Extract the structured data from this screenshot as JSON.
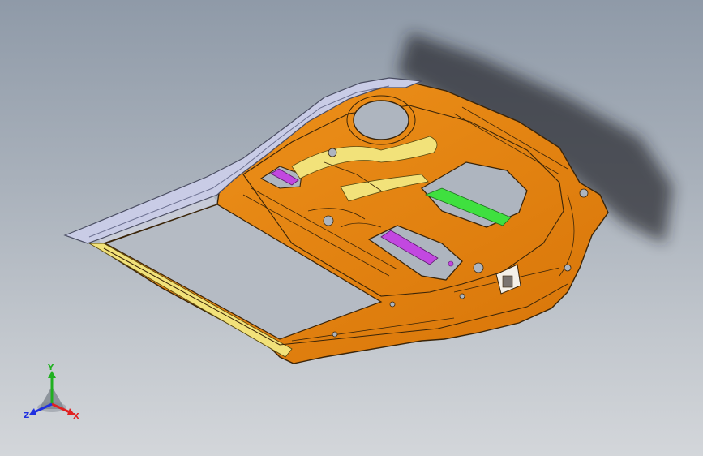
{
  "viewport": {
    "background_top": "#8f9aa8",
    "background_bottom": "#d3d6da"
  },
  "model": {
    "panel_color": "#e8860f",
    "panel_edge_color": "#3a2408",
    "frame_color": "#c9cce6",
    "highlight_yellow": "#f2e27a",
    "highlight_green": "#3fe03f",
    "highlight_magenta": "#c248e0"
  },
  "triad": {
    "x_label": "X",
    "y_label": "Y",
    "z_label": "Z",
    "x_color": "#e02020",
    "y_color": "#20b020",
    "z_color": "#2030e0"
  }
}
